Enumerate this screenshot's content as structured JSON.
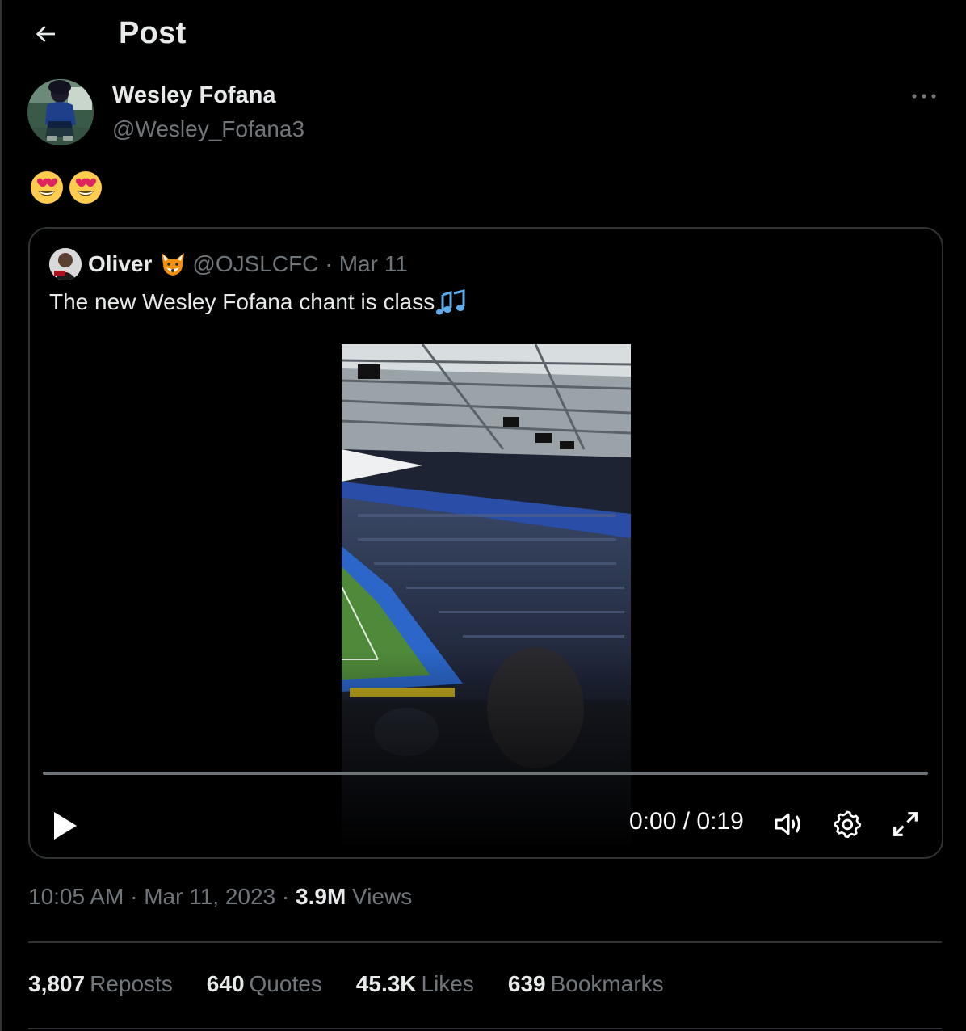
{
  "header": {
    "title": "Post",
    "back_icon": "arrow-left-icon"
  },
  "author": {
    "name": "Wesley Fofana",
    "handle": "@Wesley_Fofana3"
  },
  "tweet": {
    "emojis": [
      "heart-eyes-emoji",
      "heart-eyes-emoji"
    ]
  },
  "quote": {
    "name": "Oliver",
    "name_emoji": "fox-emoji",
    "handle": "@OJSLCFC",
    "separator": "·",
    "date": "Mar 11",
    "text": "The new Wesley Fofana chant is class",
    "text_emoji": "musical-notes-emoji",
    "video": {
      "time": "0:00 / 0:19",
      "progress": 0
    }
  },
  "meta": {
    "time": "10:05 AM",
    "separator1": " · ",
    "date": "Mar 11, 2023",
    "separator2": " · ",
    "views_count": "3.9M",
    "views_label": " Views"
  },
  "stats": {
    "reposts_count": "3,807",
    "reposts_label": "Reposts",
    "quotes_count": "640",
    "quotes_label": "Quotes",
    "likes_count": "45.3K",
    "likes_label": "Likes",
    "bookmarks_count": "639",
    "bookmarks_label": "Bookmarks"
  },
  "colors": {
    "background": "#000000",
    "text": "#e7e9ea",
    "muted": "#71767b",
    "border": "#2f3336"
  }
}
